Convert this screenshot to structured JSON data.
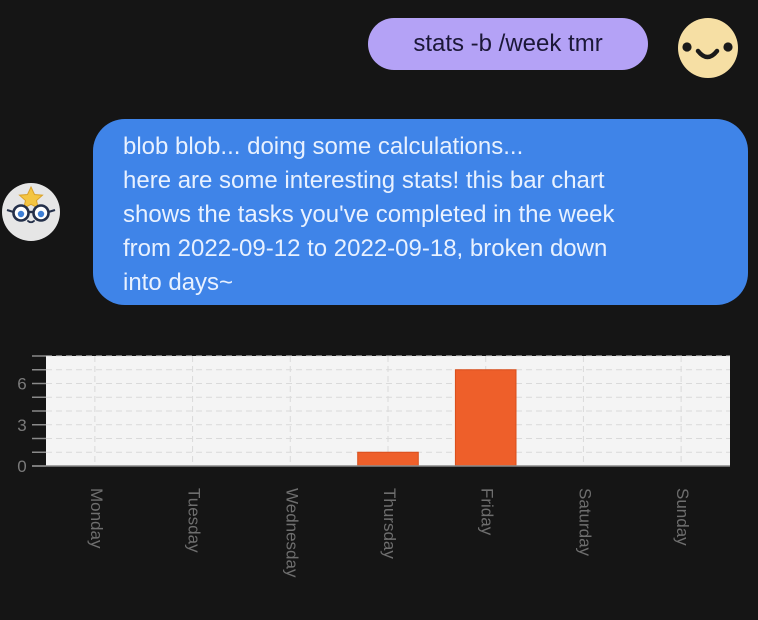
{
  "conversation": {
    "user_message": "stats -b /week tmr",
    "bot_message_lines": [
      "blob blob... doing some calculations...",
      "here are some interesting stats! this bar chart",
      "shows the tasks you've completed in the week",
      "from 2022-09-12 to 2022-09-18, broken down",
      "into days~"
    ]
  },
  "avatars": {
    "user": "smiley-face-icon",
    "bot": "blob-with-glasses-and-star-icon"
  },
  "colors": {
    "background": "#151515",
    "user_bubble": "#b4a2f6",
    "bot_bubble": "#3f84e8",
    "bar": "#ee5f2a",
    "user_avatar": "#f6dfa4"
  },
  "chart_data": {
    "type": "bar",
    "categories": [
      "Monday",
      "Tuesday",
      "Wednesday",
      "Thursday",
      "Friday",
      "Saturday",
      "Sunday"
    ],
    "values": [
      0,
      0,
      0,
      1,
      7,
      0,
      0
    ],
    "ylim": [
      0,
      8
    ],
    "yticks": [
      0,
      3,
      6
    ],
    "grid": true,
    "xlabel": "",
    "ylabel": ""
  }
}
